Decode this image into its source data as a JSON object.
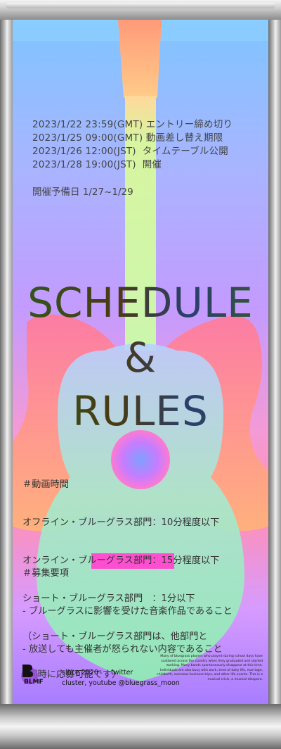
{
  "schedule": [
    "2023/1/22 23:59(GMT) エントリー締め切り",
    "2023/1/25 09:00(GMT) 動画差し替え期限",
    "2023/1/26 12:00(JST)  タイムテーブル公開",
    "2023/1/28 19:00(JST)  開催"
  ],
  "prelim_dates": "開催予備日 1/27~1/29",
  "title": {
    "line1": "SCHEDULE",
    "line2": "&",
    "line3": "RULES"
  },
  "video_time": {
    "heading": "＃動画時間",
    "lines": [
      "オフライン・ブルーグラス部門：10分程度以下",
      "オンライン・ブルーグラス部門：15分程度以下",
      "ショート・ブルーグラス部門　：1分以下",
      "（ショート・ブルーグラス部門は、他部門と",
      "  同時に応募可能です）"
    ]
  },
  "requirements": {
    "heading": "＃募集要項",
    "lines": [
      "- ブルーグラスに影響を受けた音楽作品であること",
      "- 放送しても主催者が怒られない内容であること"
    ]
  },
  "footer": {
    "logo_text": "BLMF",
    "since": "since 2020",
    "twitter": "twitter",
    "social": "cluster, youtube @bluegrass_moon",
    "note": "Many of bluegrass players who played during school days have scattered across the country when they graduated and started working. Many bands spontaneously disappear at this time. Individuals are also busy with work, tired of daily life, marriage, childbirth, overseas business trips, and other life events. This is a musical crisis, a musical diaspora."
  },
  "colors": {
    "banner_top": "#7fc5ff",
    "banner_mid": "#c39bff",
    "banner_pink": "#ff8fb5",
    "guitar_body": "#9cf0b8",
    "neck": "#d8f5a0"
  }
}
